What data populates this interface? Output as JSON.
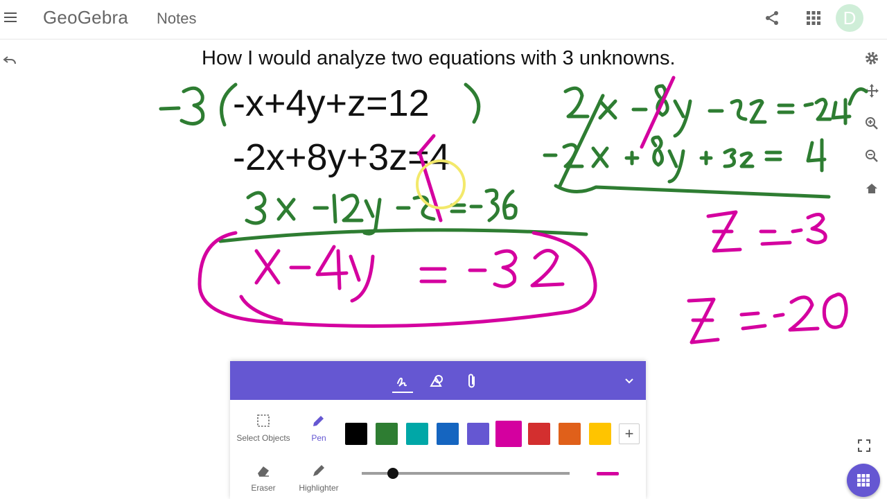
{
  "app": {
    "logo_text": "GeoGebra",
    "section_label": "Notes",
    "avatar_initial": "D"
  },
  "canvas": {
    "title": "How I would analyze two equations with 3 unknowns.",
    "equations": [
      "-x+4y+z=12",
      "-2x+8y+3z=4"
    ]
  },
  "toolbox": {
    "tools": {
      "select": "Select Objects",
      "pen": "Pen",
      "eraser": "Eraser",
      "highlighter": "Highlighter"
    },
    "selected_tool": "Pen",
    "colors": [
      "#000000",
      "#2e7d32",
      "#00a7a7",
      "#1565c0",
      "#6557d2",
      "#d4009f",
      "#d32f2f",
      "#e0601a",
      "#ffc400"
    ],
    "selected_color": "#d4009f",
    "stroke_level": 0.15,
    "icons": [
      "pen-tab-icon",
      "shapes-tab-icon",
      "attachment-tab-icon",
      "chevron-down-icon",
      "add-color-icon"
    ]
  },
  "colors": {
    "accent": "#6557d2",
    "ink_green": "#2e7d32",
    "ink_magenta": "#d4009f",
    "highlight_yellow": "#f3e96b"
  }
}
